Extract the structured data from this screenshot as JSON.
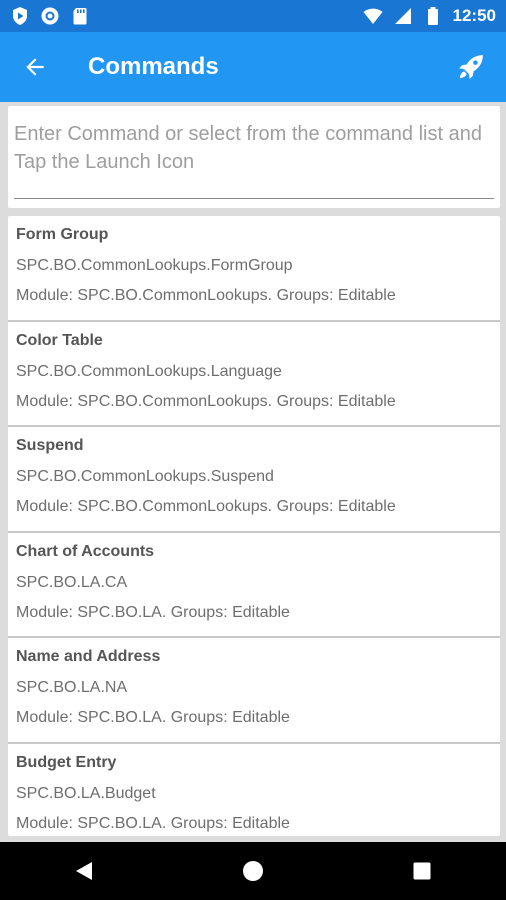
{
  "status_bar": {
    "left_icons": [
      "play-protect-icon",
      "sync-circle-icon",
      "sd-card-icon"
    ],
    "right_icons": [
      "wifi-icon",
      "signal-icon",
      "battery-icon"
    ],
    "time": "12:50"
  },
  "app_bar": {
    "back_icon": "arrow-back-icon",
    "title": "Commands",
    "launch_icon": "rocket-icon"
  },
  "command": {
    "placeholder": "Enter Command or select from the command list and Tap the Launch Icon",
    "value": ""
  },
  "commands": [
    {
      "name": "Form Group",
      "id": "SPC.BO.CommonLookups.FormGroup",
      "module": "Module: SPC.BO.CommonLookups. Groups: Editable"
    },
    {
      "name": "Color Table",
      "id": "SPC.BO.CommonLookups.Language",
      "module": "Module: SPC.BO.CommonLookups. Groups: Editable"
    },
    {
      "name": "Suspend",
      "id": "SPC.BO.CommonLookups.Suspend",
      "module": "Module: SPC.BO.CommonLookups. Groups: Editable"
    },
    {
      "name": "Chart of Accounts",
      "id": "SPC.BO.LA.CA",
      "module": "Module: SPC.BO.LA. Groups: Editable"
    },
    {
      "name": "Name and Address",
      "id": "SPC.BO.LA.NA",
      "module": "Module: SPC.BO.LA. Groups: Editable"
    },
    {
      "name": "Budget Entry",
      "id": "SPC.BO.LA.Budget",
      "module": "Module: SPC.BO.LA. Groups: Editable"
    }
  ],
  "nav_bar": {
    "icons": [
      "nav-back-icon",
      "nav-home-icon",
      "nav-recents-icon"
    ]
  },
  "colors": {
    "status_bar": "#1976D2",
    "app_bar": "#2196F3",
    "background": "#dcdcdc",
    "nav_bar": "#000000"
  }
}
